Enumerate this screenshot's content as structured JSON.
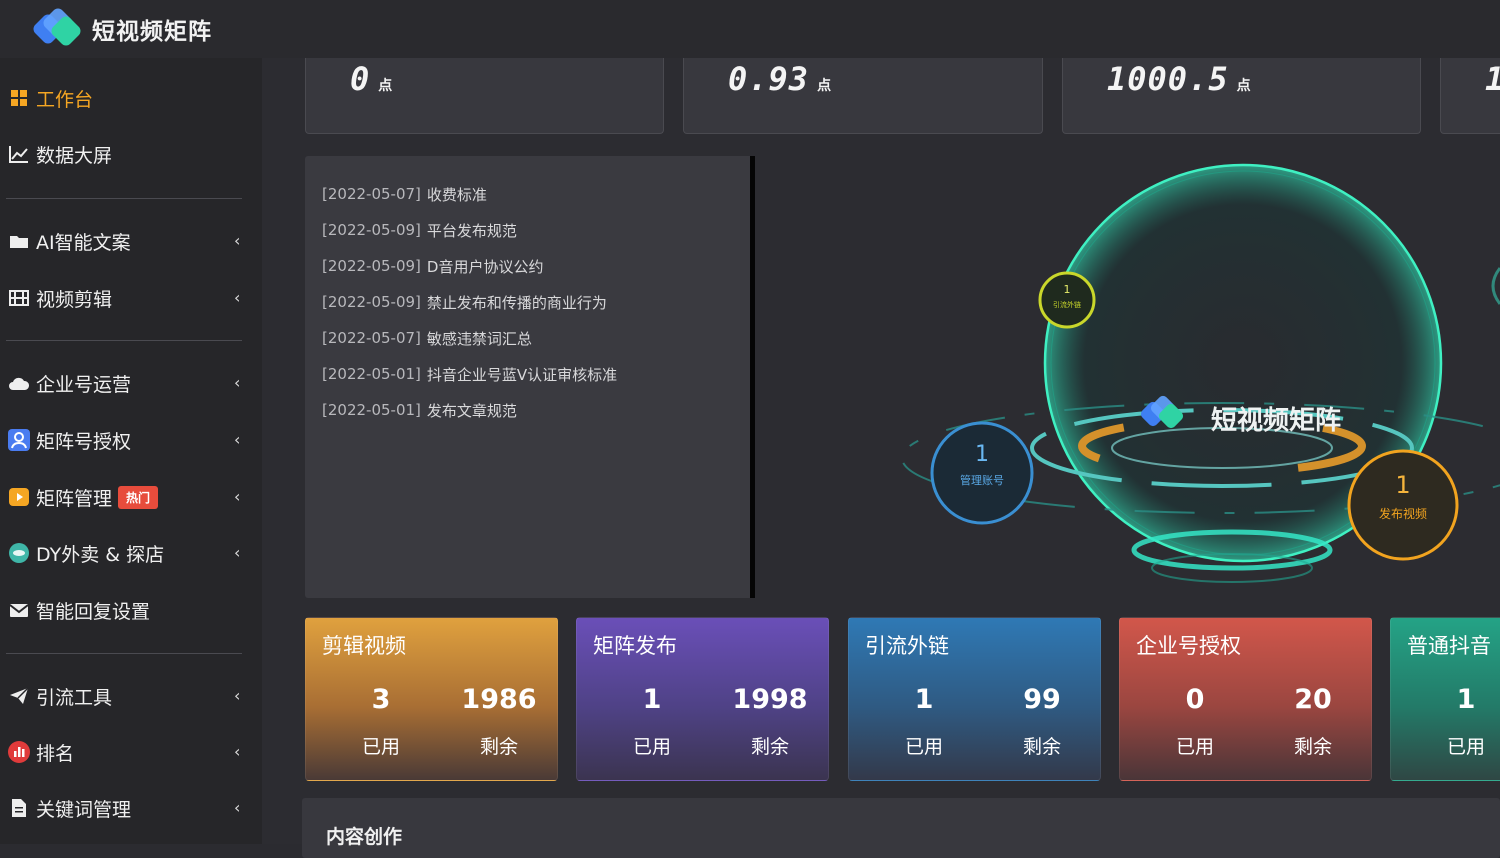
{
  "app": {
    "title": "短视频矩阵"
  },
  "sidebar": {
    "items": [
      {
        "label": "工作台",
        "icon": "windows-icon"
      },
      {
        "label": "数据大屏",
        "icon": "line-chart-icon"
      },
      {
        "label": "AI智能文案",
        "icon": "folder-icon"
      },
      {
        "label": "视频剪辑",
        "icon": "film-icon"
      },
      {
        "label": "企业号运营",
        "icon": "cloud-icon"
      },
      {
        "label": "矩阵号授权",
        "icon": "user-badge-icon"
      },
      {
        "label": "矩阵管理",
        "icon": "play-icon",
        "badge": "热门"
      },
      {
        "label": "DY外卖 & 探店",
        "icon": "location-icon"
      },
      {
        "label": "智能回复设置",
        "icon": "envelope-icon"
      },
      {
        "label": "引流工具",
        "icon": "paper-plane-icon"
      },
      {
        "label": "排名",
        "icon": "bar-chart-icon"
      },
      {
        "label": "关键词管理",
        "icon": "document-icon"
      }
    ]
  },
  "stats": [
    {
      "value": "0",
      "unit": "点"
    },
    {
      "value": "0.93",
      "unit": "点"
    },
    {
      "value": "1000.5",
      "unit": "点"
    },
    {
      "value": "1",
      "unit": ""
    }
  ],
  "notices": [
    {
      "date": "[2022-05-07]",
      "title": "收费标准"
    },
    {
      "date": "[2022-05-09]",
      "title": "平台发布规范"
    },
    {
      "date": "[2022-05-09]",
      "title": "D音用户协议公约"
    },
    {
      "date": "[2022-05-09]",
      "title": "禁止发布和传播的商业行为"
    },
    {
      "date": "[2022-05-07]",
      "title": "敏感违禁词汇总"
    },
    {
      "date": "[2022-05-01]",
      "title": "抖音企业号蓝V认证审核标准"
    },
    {
      "date": "[2022-05-01]",
      "title": "发布文章规范"
    }
  ],
  "visual": {
    "brand": "短视频矩阵",
    "orbs": [
      {
        "count": "1",
        "label": "引流外链"
      },
      {
        "count": "1",
        "label": "管理账号"
      },
      {
        "count": "1",
        "label": "发布视频"
      }
    ]
  },
  "cards": [
    {
      "title": "剪辑视频",
      "used": "3",
      "used_label": "已用",
      "remain": "1986",
      "remain_label": "剩余",
      "color_top": "#e0a13e",
      "color_bottom": "#4a3a36"
    },
    {
      "title": "矩阵发布",
      "used": "1",
      "used_label": "已用",
      "remain": "1998",
      "remain_label": "剩余",
      "color_top": "#6a4fb8",
      "color_bottom": "#3b3450"
    },
    {
      "title": "引流外链",
      "used": "1",
      "used_label": "已用",
      "remain": "99",
      "remain_label": "剩余",
      "color_top": "#2f79b5",
      "color_bottom": "#33394a"
    },
    {
      "title": "企业号授权",
      "used": "0",
      "used_label": "已用",
      "remain": "20",
      "remain_label": "剩余",
      "color_top": "#d2574b",
      "color_bottom": "#4a3538"
    },
    {
      "title": "普通抖音",
      "used": "1",
      "used_label": "已用",
      "remain": "",
      "remain_label": "",
      "color_top": "#24a386",
      "color_bottom": "#2f4744"
    }
  ],
  "content": {
    "title": "内容创作"
  }
}
